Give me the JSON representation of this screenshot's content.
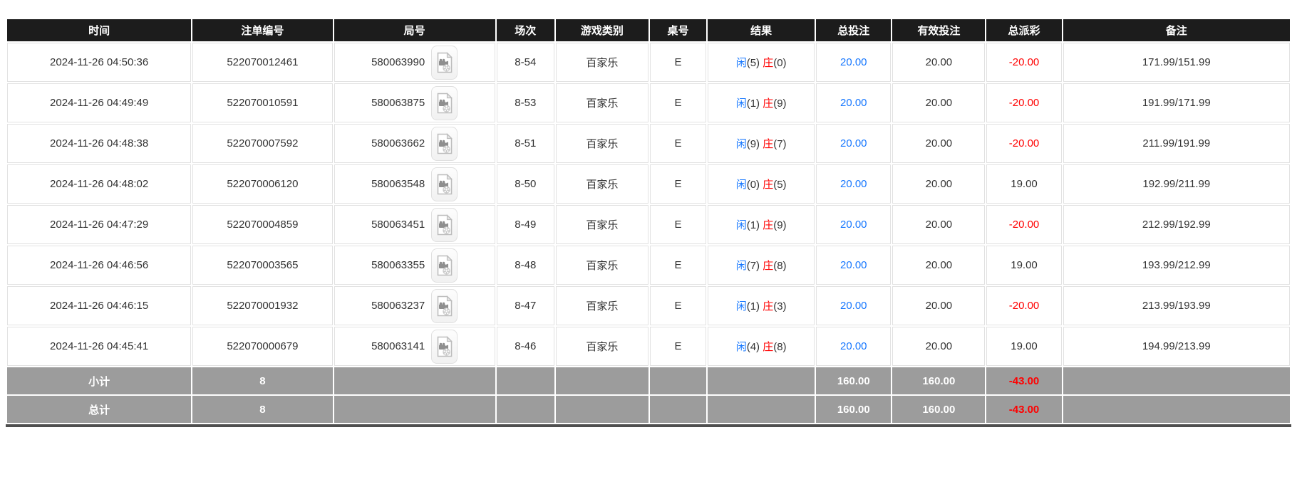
{
  "colors": {
    "header_bg": "#1c1c1c",
    "footer_bg": "#9c9c9c",
    "player_blue": "#1677ff",
    "banker_red": "#ff0000",
    "negative_red": "#ff0000",
    "bottom_edge": "#4f4f4f"
  },
  "icons": {
    "round_video": "video-icon"
  },
  "table": {
    "columns": [
      {
        "key": "time",
        "label": "时间"
      },
      {
        "key": "bet_id",
        "label": "注单编号"
      },
      {
        "key": "round_id",
        "label": "局号"
      },
      {
        "key": "session",
        "label": "场次"
      },
      {
        "key": "game_type",
        "label": "游戏类别"
      },
      {
        "key": "table_no",
        "label": "桌号"
      },
      {
        "key": "result",
        "label": "结果"
      },
      {
        "key": "total_bet",
        "label": "总投注"
      },
      {
        "key": "valid_bet",
        "label": "有效投注"
      },
      {
        "key": "total_payout",
        "label": "总派彩"
      },
      {
        "key": "remark",
        "label": "备注"
      }
    ],
    "rows": [
      {
        "time": "2024-11-26 04:50:36",
        "bet_id": "522070012461",
        "round_id": "580063990",
        "session": "8-54",
        "game_type": "百家乐",
        "table_no": "E",
        "result": {
          "player": "闲",
          "player_score": "(5) ",
          "banker": "庄",
          "banker_score": "(0)"
        },
        "total_bet": "20.00",
        "valid_bet": "20.00",
        "total_payout": "-20.00",
        "remark": "171.99/151.99"
      },
      {
        "time": "2024-11-26 04:49:49",
        "bet_id": "522070010591",
        "round_id": "580063875",
        "session": "8-53",
        "game_type": "百家乐",
        "table_no": "E",
        "result": {
          "player": "闲",
          "player_score": "(1) ",
          "banker": "庄",
          "banker_score": "(9)"
        },
        "total_bet": "20.00",
        "valid_bet": "20.00",
        "total_payout": "-20.00",
        "remark": "191.99/171.99"
      },
      {
        "time": "2024-11-26 04:48:38",
        "bet_id": "522070007592",
        "round_id": "580063662",
        "session": "8-51",
        "game_type": "百家乐",
        "table_no": "E",
        "result": {
          "player": "闲",
          "player_score": "(9) ",
          "banker": "庄",
          "banker_score": "(7)"
        },
        "total_bet": "20.00",
        "valid_bet": "20.00",
        "total_payout": "-20.00",
        "remark": "211.99/191.99"
      },
      {
        "time": "2024-11-26 04:48:02",
        "bet_id": "522070006120",
        "round_id": "580063548",
        "session": "8-50",
        "game_type": "百家乐",
        "table_no": "E",
        "result": {
          "player": "闲",
          "player_score": "(0) ",
          "banker": "庄",
          "banker_score": "(5)"
        },
        "total_bet": "20.00",
        "valid_bet": "20.00",
        "total_payout": "19.00",
        "remark": "192.99/211.99"
      },
      {
        "time": "2024-11-26 04:47:29",
        "bet_id": "522070004859",
        "round_id": "580063451",
        "session": "8-49",
        "game_type": "百家乐",
        "table_no": "E",
        "result": {
          "player": "闲",
          "player_score": "(1) ",
          "banker": "庄",
          "banker_score": "(9)"
        },
        "total_bet": "20.00",
        "valid_bet": "20.00",
        "total_payout": "-20.00",
        "remark": "212.99/192.99"
      },
      {
        "time": "2024-11-26 04:46:56",
        "bet_id": "522070003565",
        "round_id": "580063355",
        "session": "8-48",
        "game_type": "百家乐",
        "table_no": "E",
        "result": {
          "player": "闲",
          "player_score": "(7) ",
          "banker": "庄",
          "banker_score": "(8)"
        },
        "total_bet": "20.00",
        "valid_bet": "20.00",
        "total_payout": "19.00",
        "remark": "193.99/212.99"
      },
      {
        "time": "2024-11-26 04:46:15",
        "bet_id": "522070001932",
        "round_id": "580063237",
        "session": "8-47",
        "game_type": "百家乐",
        "table_no": "E",
        "result": {
          "player": "闲",
          "player_score": "(1) ",
          "banker": "庄",
          "banker_score": "(3)"
        },
        "total_bet": "20.00",
        "valid_bet": "20.00",
        "total_payout": "-20.00",
        "remark": "213.99/193.99"
      },
      {
        "time": "2024-11-26 04:45:41",
        "bet_id": "522070000679",
        "round_id": "580063141",
        "session": "8-46",
        "game_type": "百家乐",
        "table_no": "E",
        "result": {
          "player": "闲",
          "player_score": "(4) ",
          "banker": "庄",
          "banker_score": "(8)"
        },
        "total_bet": "20.00",
        "valid_bet": "20.00",
        "total_payout": "19.00",
        "remark": "194.99/213.99"
      }
    ],
    "footer_rows": [
      {
        "label": "小计",
        "count": "8",
        "total_bet": "160.00",
        "valid_bet": "160.00",
        "total_payout": "-43.00"
      },
      {
        "label": "总计",
        "count": "8",
        "total_bet": "160.00",
        "valid_bet": "160.00",
        "total_payout": "-43.00"
      }
    ]
  }
}
